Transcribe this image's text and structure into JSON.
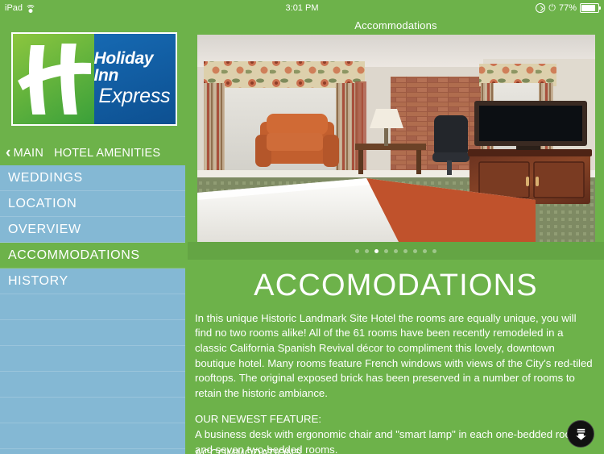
{
  "statusbar": {
    "device": "iPad",
    "wifi_icon": "wifi-icon",
    "time": "3:01 PM",
    "rotation_lock_icon": "rotation-lock-icon",
    "bluetooth_icon": "bluetooth-icon",
    "battery_percent": "77%",
    "battery_icon": "battery-icon"
  },
  "sidebar": {
    "logo": {
      "brand_line1": "Holiday Inn",
      "brand_line2": "Express",
      "monogram": "H"
    },
    "nav_header": {
      "back_icon": "chevron-left-icon",
      "back_label": "MAIN",
      "section_label": "HOTEL AMENITIES"
    },
    "items": [
      {
        "label": "WEDDINGS",
        "active": false
      },
      {
        "label": "LOCATION",
        "active": false
      },
      {
        "label": "OVERVIEW",
        "active": false
      },
      {
        "label": "ACCOMMODATIONS",
        "active": true
      },
      {
        "label": "HISTORY",
        "active": false
      }
    ]
  },
  "content": {
    "header_title": "Accommodations",
    "photo_alt": "hotel-room-photo",
    "pager": {
      "total": 9,
      "active_index": 2
    },
    "page_title": "ACCOMODATIONS",
    "paragraph_1": "In this unique Historic Landmark Site Hotel the rooms are equally unique, you will find no two rooms alike! All of the 61 rooms have been recently remodeled in a classic California Spanish Revival décor to compliment this lovely, downtown boutique hotel. Many rooms feature French windows with views of the City's red-tiled rooftops. The original exposed brick has been preserved in a number of rooms to retain the historic ambiance.",
    "heading_2": "OUR NEWEST FEATURE:",
    "paragraph_2": "A business desk with ergonomic chair and \"smart lamp\" in each one-bedded room and seven two-bedded rooms.",
    "clipped_heading": "ACCOMMODATIONS",
    "scroll_button_icon": "scroll-down-icon"
  },
  "colors": {
    "brand_green": "#6db24a",
    "sidebar_blue": "#84b8d4",
    "logo_blue": "#0d5091",
    "white": "#ffffff"
  }
}
